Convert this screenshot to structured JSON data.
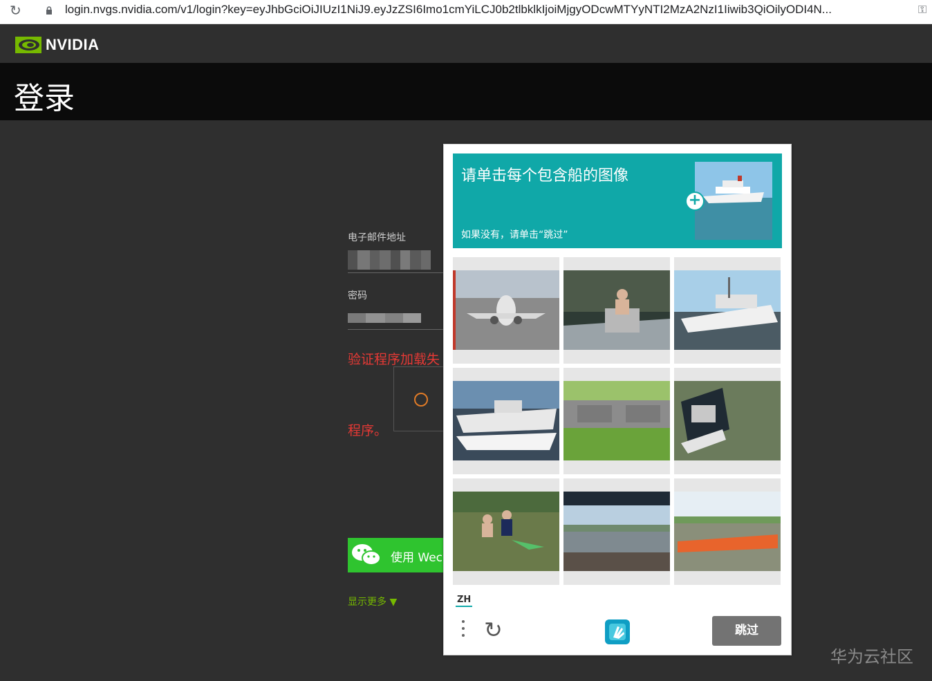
{
  "browser": {
    "url": "login.nvgs.nvidia.com/v1/login?key=eyJhbGciOiJIUzI1NiJ9.eyJzZSI6Imo1cmYiLCJ0b2tlbklkIjoiMjgyODcwMTYyNTI2MzA2NzI1Iiwib3QiOilyODI4N..."
  },
  "header": {
    "brand": "NVIDIA",
    "title": "登录"
  },
  "form": {
    "email_label": "电子邮件地址",
    "password_label": "密码",
    "error_line1": "验证程序加载失",
    "error_line2": "程序。",
    "wechat_label": "使用 Wec",
    "show_more": "显示更多 ▼"
  },
  "captcha": {
    "prompt_title": "请单击每个包含船的图像",
    "prompt_sub": "如果没有，请单击“跳过”",
    "tiles": [
      "airplane",
      "man-in-boat",
      "yacht-harbor",
      "speedboat-marina",
      "freight-train",
      "motorboat",
      "people-in-water",
      "river-city",
      "dragon-boat-race"
    ],
    "language": "ZH",
    "skip_label": "跳过",
    "accent_color": "#10a8a8"
  },
  "watermark": "华为云社区"
}
